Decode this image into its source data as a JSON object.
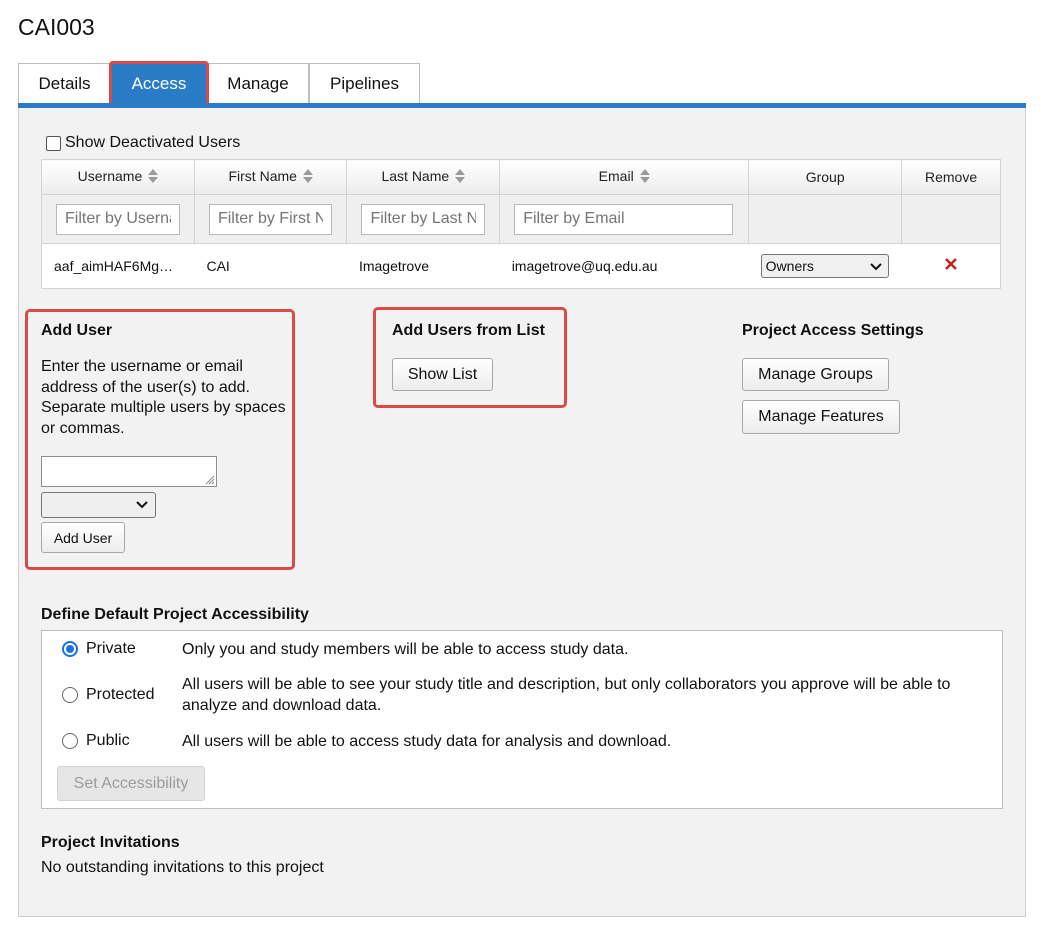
{
  "project": {
    "title": "CAI003"
  },
  "tabs": [
    {
      "label": "Details"
    },
    {
      "label": "Access"
    },
    {
      "label": "Manage"
    },
    {
      "label": "Pipelines"
    }
  ],
  "show_deactivated": {
    "label": "Show Deactivated Users",
    "checked": false
  },
  "users_table": {
    "columns": [
      "Username",
      "First Name",
      "Last Name",
      "Email",
      "Group",
      "Remove"
    ],
    "filters": {
      "username": "Filter by Username",
      "first_name": "Filter by First Name",
      "last_name": "Filter by Last Name",
      "email": "Filter by Email"
    },
    "filter_visible": {
      "username": "Filter by Userna",
      "first_name": "Filter by First N",
      "last_name": "Filter by Last N",
      "email": "Filter by Email"
    },
    "rows": [
      {
        "username": "aaf_aimHAF6Mg…",
        "first_name": "CAI",
        "last_name": "Imagetrove",
        "email": "imagetrove@uq.edu.au",
        "group": "Owners",
        "remove_icon": "x-icon"
      }
    ]
  },
  "add_user": {
    "title": "Add User",
    "description": "Enter the username or email address of the user(s) to add. Separate multiple users by spaces or commas.",
    "textarea_value": "",
    "select_value": "",
    "button_label": "Add User"
  },
  "add_from_list": {
    "title": "Add Users from List",
    "button_label": "Show List"
  },
  "access_settings": {
    "title": "Project Access Settings",
    "manage_groups_label": "Manage Groups",
    "manage_features_label": "Manage Features"
  },
  "accessibility": {
    "title": "Define Default Project Accessibility",
    "options": [
      {
        "label": "Private",
        "description": "Only you and study members will be able to access study data.",
        "selected": true
      },
      {
        "label": "Protected",
        "description": "All users will be able to see your study title and description, but only collaborators you approve will be able to analyze and download data.",
        "selected": false
      },
      {
        "label": "Public",
        "description": "All users will be able to access study data for analysis and download.",
        "selected": false
      }
    ],
    "button_label": "Set Accessibility"
  },
  "invitations": {
    "title": "Project Invitations",
    "message": "No outstanding invitations to this project"
  },
  "colors": {
    "accent": "#2a7bc6",
    "highlight": "#d94a4a",
    "remove": "#cc1f1f"
  }
}
